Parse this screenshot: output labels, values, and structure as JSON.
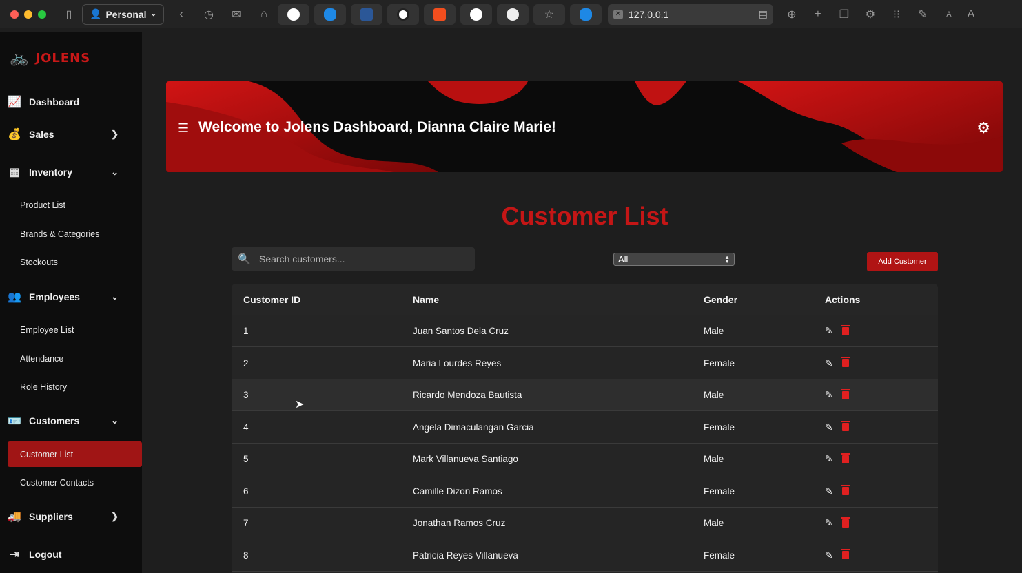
{
  "browser": {
    "profile": "Personal",
    "url": "127.0.0.1"
  },
  "brand": {
    "name": "JOLENS",
    "accent": "#c81818"
  },
  "sidebar": {
    "items": [
      {
        "label": "Dashboard",
        "icon": "chart-line-icon"
      },
      {
        "label": "Sales",
        "icon": "money-bag-icon"
      },
      {
        "label": "Inventory",
        "icon": "boxes-icon"
      },
      {
        "label": "Product List"
      },
      {
        "label": "Brands & Categories"
      },
      {
        "label": "Stockouts"
      },
      {
        "label": "Employees",
        "icon": "users-icon"
      },
      {
        "label": "Employee List"
      },
      {
        "label": "Attendance"
      },
      {
        "label": "Role History"
      },
      {
        "label": "Customers",
        "icon": "contact-card-icon"
      },
      {
        "label": "Customer List"
      },
      {
        "label": "Customer Contacts"
      },
      {
        "label": "Suppliers",
        "icon": "truck-icon"
      },
      {
        "label": "Logout",
        "icon": "logout-icon"
      }
    ]
  },
  "banner": {
    "title": "Welcome to Jolens Dashboard, Dianna Claire Marie!"
  },
  "main": {
    "title": "Customer List",
    "search_placeholder": "Search customers...",
    "filter_value": "All",
    "add_button": "Add Customer",
    "columns": [
      "Customer ID",
      "Name",
      "Gender",
      "Actions"
    ],
    "rows": [
      {
        "id": "1",
        "name": "Juan Santos Dela Cruz",
        "gender": "Male"
      },
      {
        "id": "2",
        "name": "Maria Lourdes Reyes",
        "gender": "Female"
      },
      {
        "id": "3",
        "name": "Ricardo Mendoza Bautista",
        "gender": "Male"
      },
      {
        "id": "4",
        "name": "Angela Dimaculangan Garcia",
        "gender": "Female"
      },
      {
        "id": "5",
        "name": "Mark Villanueva Santiago",
        "gender": "Male"
      },
      {
        "id": "6",
        "name": "Camille Dizon Ramos",
        "gender": "Female"
      },
      {
        "id": "7",
        "name": "Jonathan Ramos Cruz",
        "gender": "Male"
      },
      {
        "id": "8",
        "name": "Patricia Reyes Villanueva",
        "gender": "Female"
      }
    ]
  }
}
